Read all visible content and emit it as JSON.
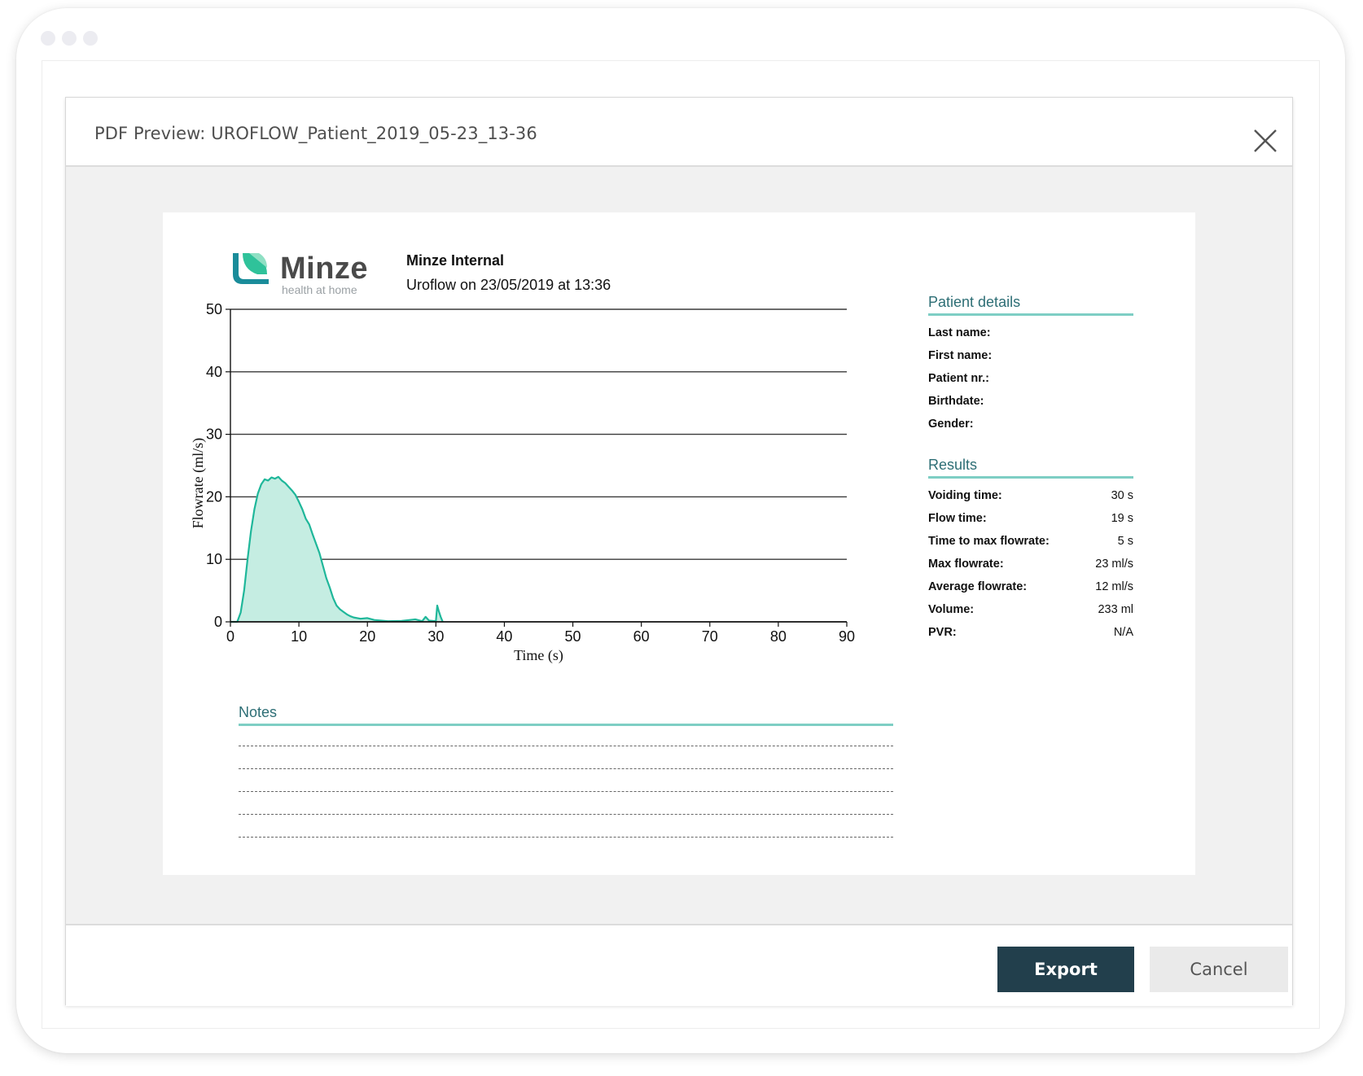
{
  "window": {
    "title": "PDF Preview: UROFLOW_Patient_2019_05-23_13-36"
  },
  "report": {
    "logo": {
      "name": "Minze",
      "tagline": "health at home"
    },
    "organization": "Minze Internal",
    "subtitle": "Uroflow on 23/05/2019 at 13:36"
  },
  "patient_details": {
    "heading": "Patient details",
    "fields": [
      {
        "label": "Last name:",
        "value": ""
      },
      {
        "label": "First name:",
        "value": ""
      },
      {
        "label": "Patient nr.:",
        "value": ""
      },
      {
        "label": "Birthdate:",
        "value": ""
      },
      {
        "label": "Gender:",
        "value": ""
      }
    ]
  },
  "results": {
    "heading": "Results",
    "fields": [
      {
        "label": "Voiding time:",
        "value": "30 s"
      },
      {
        "label": "Flow time:",
        "value": "19 s"
      },
      {
        "label": "Time to max flowrate:",
        "value": "5 s"
      },
      {
        "label": "Max flowrate:",
        "value": "23 ml/s"
      },
      {
        "label": "Average flowrate:",
        "value": "12 ml/s"
      },
      {
        "label": "Volume:",
        "value": "233 ml"
      },
      {
        "label": "PVR:",
        "value": "N/A"
      }
    ]
  },
  "notes": {
    "heading": "Notes",
    "line_count": 5
  },
  "footer": {
    "export_label": "Export",
    "cancel_label": "Cancel"
  },
  "colors": {
    "accent": "#1fb79a",
    "fill": "#c5ede2",
    "heading": "#2d6e75",
    "rule": "#7ecec4",
    "export_bg": "#223f4c"
  },
  "chart_data": {
    "type": "area",
    "title": "",
    "xlabel": "Time (s)",
    "ylabel": "Flowrate (ml/s)",
    "xlim": [
      0,
      90
    ],
    "ylim": [
      0,
      50
    ],
    "xticks": [
      0,
      10,
      20,
      30,
      40,
      50,
      60,
      70,
      80,
      90
    ],
    "yticks": [
      0,
      10,
      20,
      30,
      40,
      50
    ],
    "grid": "horizontal",
    "series": [
      {
        "x": [
          0,
          1,
          1.5,
          2,
          2.5,
          3,
          3.5,
          4,
          4.5,
          5,
          5.5,
          6,
          6.5,
          7,
          7.5,
          8,
          8.5,
          9,
          9.5,
          10,
          10.5,
          11,
          11.5,
          12,
          12.5,
          13,
          13.5,
          14,
          14.5,
          15,
          15.5,
          16,
          16.5,
          17,
          17.5,
          18,
          19,
          20,
          21,
          22,
          23,
          25,
          27,
          28,
          28.5,
          29,
          30,
          30.2,
          30.4,
          30.7,
          31
        ],
        "y": [
          0,
          0,
          1.5,
          5,
          10,
          14.5,
          18,
          20.5,
          22,
          22.8,
          22.6,
          23.1,
          22.9,
          23.2,
          22.6,
          22.2,
          21.6,
          21,
          20.3,
          19.2,
          18,
          16.5,
          15.6,
          14,
          12.5,
          11,
          9,
          7,
          5.5,
          3.8,
          2.6,
          2,
          1.6,
          1.2,
          0.9,
          0.7,
          0.5,
          0.6,
          0.3,
          0.2,
          0.1,
          0.15,
          0.4,
          0.1,
          0.8,
          0.2,
          0.1,
          2.6,
          1.8,
          0.8,
          0
        ]
      }
    ]
  }
}
